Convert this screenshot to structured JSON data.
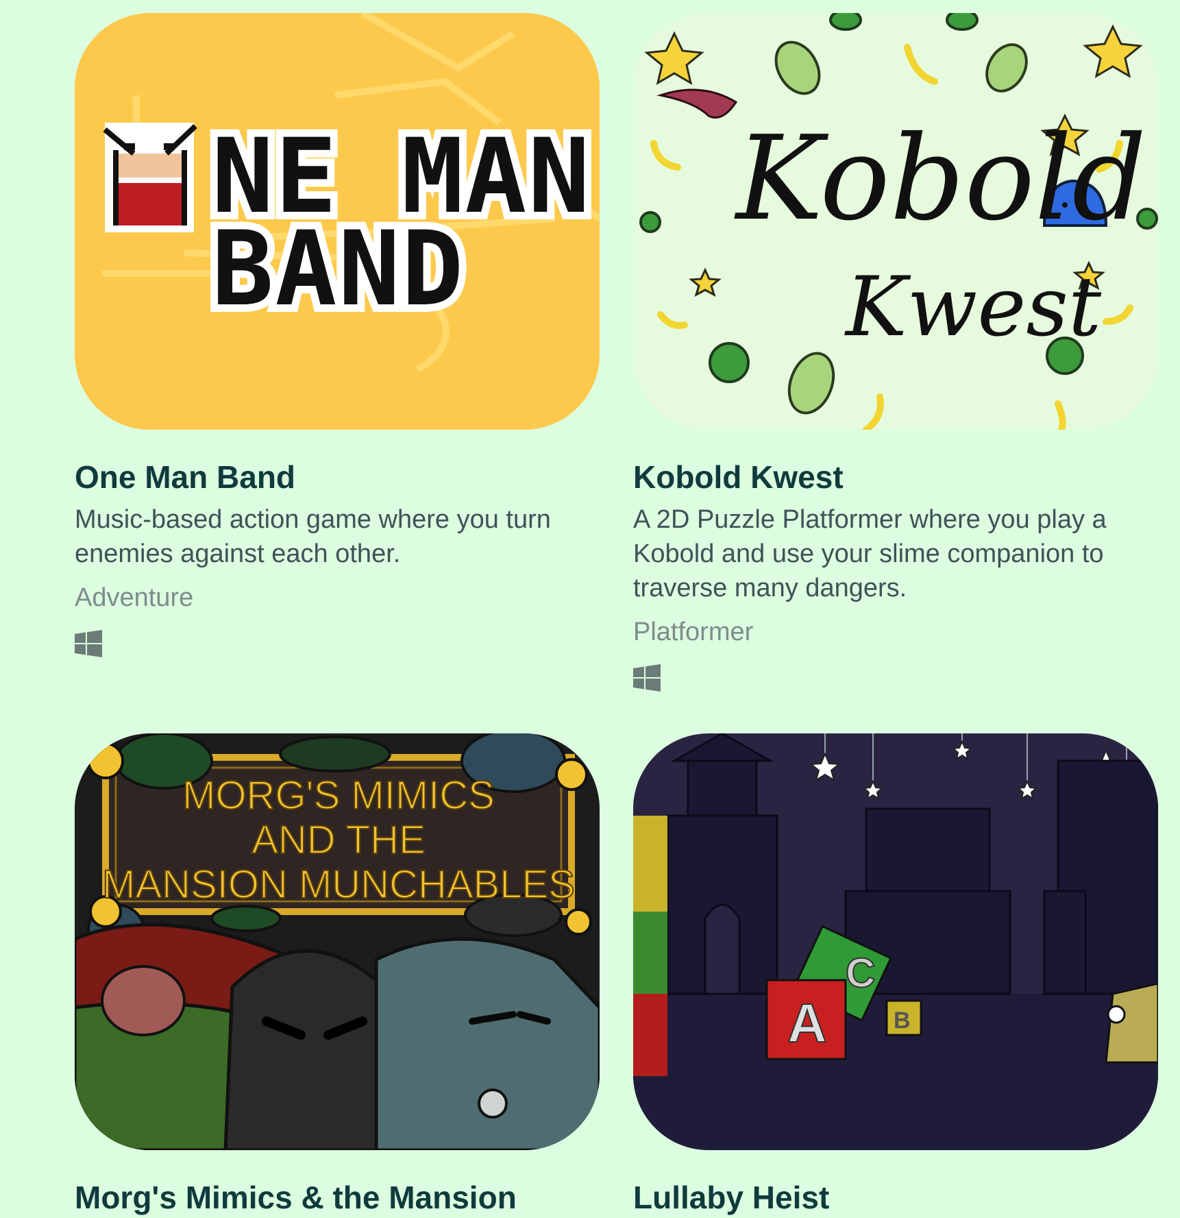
{
  "games": [
    {
      "title": "One Man Band",
      "description": "Music-based action game where you turn enemies against each other.",
      "genre": "Adventure",
      "platform_icon": "windows-icon",
      "cover": {
        "logo_line1": "NE MAN",
        "logo_line2": "BAND",
        "bg_color": "#fdc94c"
      }
    },
    {
      "title": "Kobold Kwest",
      "description": "A 2D Puzzle Platformer where you play a Kobold and use your slime companion to traverse many dangers.",
      "genre": "Platformer",
      "platform_icon": "windows-icon",
      "cover": {
        "logo_line1": "Kobold",
        "logo_line2": "Kwest",
        "bg_color": "#e6fadd"
      }
    },
    {
      "title": "Morg's Mimics & the Mansion",
      "cover": {
        "logo_line1": "MORG'S MIMICS",
        "logo_line2": "AND THE",
        "logo_line3": "MANSION MUNCHABLES",
        "bg_color": "#2b2b2b"
      }
    },
    {
      "title": "Lullaby Heist",
      "cover": {
        "block_letter_a": "A",
        "block_letter_c": "C",
        "block_letter_b": "B",
        "bg_color": "#2a2442"
      }
    }
  ],
  "colors": {
    "page_bg": "#dcfde0",
    "title": "#0f3b3d",
    "description": "#3d5357",
    "genre": "#7e8c8b",
    "platform_icon": "#6b7b78"
  }
}
